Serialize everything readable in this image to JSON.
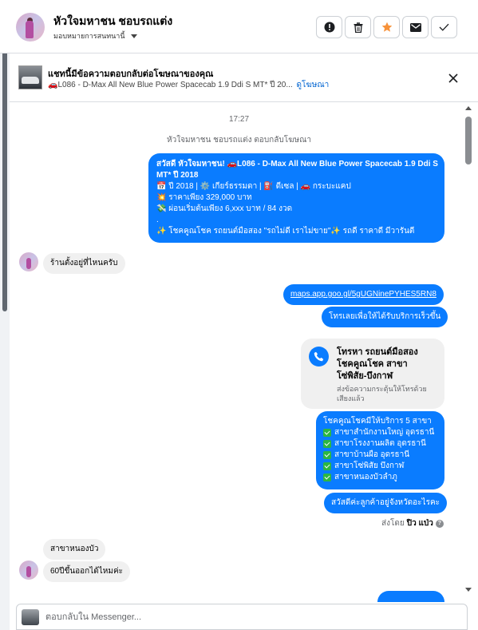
{
  "header": {
    "contact_name": "หัวใจมหาชน ชอบรถแต่ง",
    "assignee_label": "มอบหมายการสนทนานี้",
    "buttons": [
      {
        "icon": "exclamation-icon"
      },
      {
        "icon": "trash-icon"
      },
      {
        "icon": "star-icon"
      },
      {
        "icon": "envelope-icon"
      },
      {
        "icon": "check-icon"
      }
    ],
    "colors": {
      "star": "#f7923a"
    }
  },
  "ad_banner": {
    "title": "แชทนี้มีข้อความตอบกลับต่อโฆษณาของคุณ",
    "subtitle": "🚗L086 - D-Max All New Blue Power Spacecab 1.9 Ddi S MT* ปี 20...",
    "link": "ดูโฆษณา"
  },
  "chat": {
    "time": "17:27",
    "replied_note": "หัวใจมหาชน ชอบรถแต่ง ตอบกลับโฆษณา",
    "ad_message": {
      "line1": "สวัสดี หัวใจมหาชน! 🚗L086 - D-Max All New Blue Power Spacecab 1.9 Ddi S",
      "line2": "MT* ปี 2018",
      "line3": "📅 ปี 2018 | ⚙️ เกียร์ธรรมดา | ⛽ ดีเซล | 🚗 กระบะแคป",
      "line4": "💥 ราคาเพียง 329,000 บาท",
      "line5": "💸 ผ่อนเริ่มต้นเพียง 6,xxx บาท / 84 งวด",
      "line6": ".",
      "line7": "✨ โชคคูณโชค รถยนต์มือสอง \"รถไม่ดี เราไม่ขาย\"✨ รถดี ราคาดี มีวารันตี"
    },
    "customer_q1": "ร้านตั้งอยู่ที่ไหนครับ",
    "map_link": "maps.app.goo.gl/5gUGNinePYHES5RN8",
    "call_now": "โทรเลยเพื่อให้ได้รับบริการเร็วขึ้น",
    "call_card": {
      "title": "โทรหา รถยนต์มือสอง โชคคูณโชค สาขาโซ่พิสัย-บึงกาฬ",
      "subtitle": "ส่งข้อความกระตุ้นให้โทรด้วยเสียงแล้ว"
    },
    "branches": {
      "title": "โชคคูณโชคมีให้บริการ 5 สาขา",
      "items": [
        "สาขาสำนักงานใหญ่ อุดรธานี",
        "สาขาโรงงานผลิต อุดรธานี",
        "สาขาบ้านผือ อุดรธานี",
        "สาขาโซ่พิสัย บึงกาฬ",
        "สาขาหนองบัวลำภู"
      ]
    },
    "hello_msg": "สวัสดีค่ะลูกค้าอยู่จังหวัดอะไรคะ",
    "sent_by_prefix": "ส่งโดย",
    "sent_by_name": "ปิว แป่ว",
    "customer_q2": "สาขาหนองบัว",
    "customer_q3": "60ปีขึ้นออกได้ไหมค่ะ",
    "colors": {
      "bubble_blue": "#0a7cff",
      "bubble_gray": "#f0f0f0"
    }
  },
  "composer": {
    "placeholder": "ตอบกลับใน Messenger..."
  }
}
